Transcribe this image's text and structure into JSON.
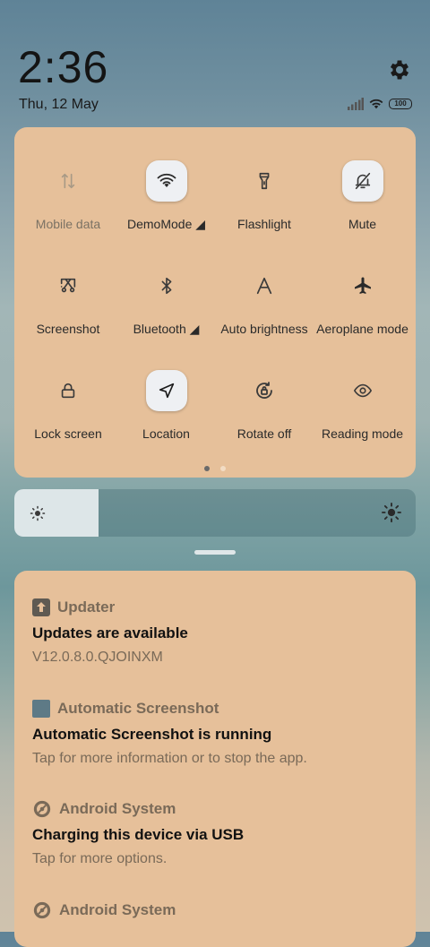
{
  "header": {
    "time": "2:36",
    "date": "Thu, 12 May",
    "battery": "100"
  },
  "tiles": [
    {
      "label": "Mobile data",
      "icon": "mobile-data-icon",
      "active": false,
      "dim": true
    },
    {
      "label": "DemoMode ◢",
      "icon": "wifi-icon",
      "active": true,
      "dim": false
    },
    {
      "label": "Flashlight",
      "icon": "flashlight-icon",
      "active": false,
      "dim": false
    },
    {
      "label": "Mute",
      "icon": "bell-off-icon",
      "active": true,
      "dim": false
    },
    {
      "label": "Screenshot",
      "icon": "screenshot-icon",
      "active": false,
      "dim": false
    },
    {
      "label": "Bluetooth ◢",
      "icon": "bluetooth-icon",
      "active": false,
      "dim": false
    },
    {
      "label": "Auto brightness",
      "icon": "auto-brightness-icon",
      "active": false,
      "dim": false
    },
    {
      "label": "Aeroplane mode",
      "icon": "aeroplane-icon",
      "active": false,
      "dim": false
    },
    {
      "label": "Lock screen",
      "icon": "lock-icon",
      "active": false,
      "dim": false
    },
    {
      "label": "Location",
      "icon": "location-icon",
      "active": true,
      "dim": false
    },
    {
      "label": "Rotate off",
      "icon": "rotate-lock-icon",
      "active": false,
      "dim": false
    },
    {
      "label": "Reading mode",
      "icon": "eye-icon",
      "active": false,
      "dim": false
    }
  ],
  "brightness": {
    "level": 0.21
  },
  "notifications": [
    {
      "app": "Updater",
      "title": "Updates are available",
      "body": "V12.0.8.0.QJOINXM",
      "icon": "updater-icon"
    },
    {
      "app": "Automatic Screenshot",
      "title": "Automatic Screenshot is running",
      "body": "Tap for more information or to stop the app.",
      "icon": "app-square-icon"
    },
    {
      "app": "Android System",
      "title": "Charging this device via USB",
      "body": "Tap for more options.",
      "icon": "android-system-icon"
    },
    {
      "app": "Android System",
      "title": "",
      "body": "",
      "icon": "android-system-icon"
    }
  ]
}
